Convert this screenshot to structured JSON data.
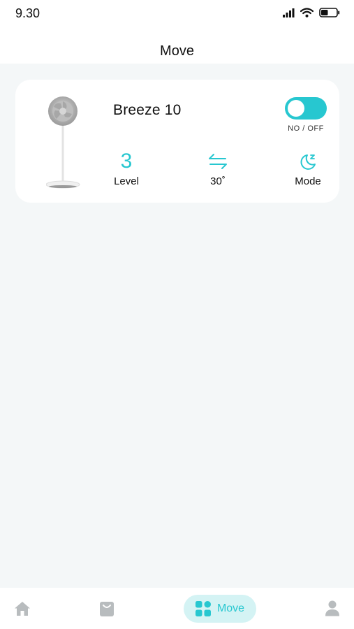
{
  "status_bar": {
    "time": "9.30",
    "icons": [
      "cellular-signal-icon",
      "wifi-icon",
      "battery-icon"
    ],
    "battery_level": 0.45
  },
  "header": {
    "title": "Move"
  },
  "device_card": {
    "name": "Breeze 10",
    "image": "standing-fan-image",
    "power": {
      "on": true,
      "label": "NO / OFF"
    },
    "stats": {
      "level": {
        "value": "3",
        "label": "Level"
      },
      "oscillation": {
        "icon": "oscillation-arrows-icon",
        "label": "30˚"
      },
      "mode": {
        "icon": "moon-sleep-icon",
        "label": "Mode"
      }
    }
  },
  "tab_bar": {
    "items": [
      {
        "icon": "home-icon",
        "active": false
      },
      {
        "icon": "shopping-bag-icon",
        "active": false
      },
      {
        "icon": "grid-apps-icon",
        "label": "Move",
        "active": true
      },
      {
        "icon": "user-icon",
        "active": false
      }
    ]
  },
  "colors": {
    "accent": "#27c7d0",
    "accent_light": "#d4f3f4",
    "background": "#f4f7f8",
    "inactive_icon": "#b8bcbe"
  }
}
